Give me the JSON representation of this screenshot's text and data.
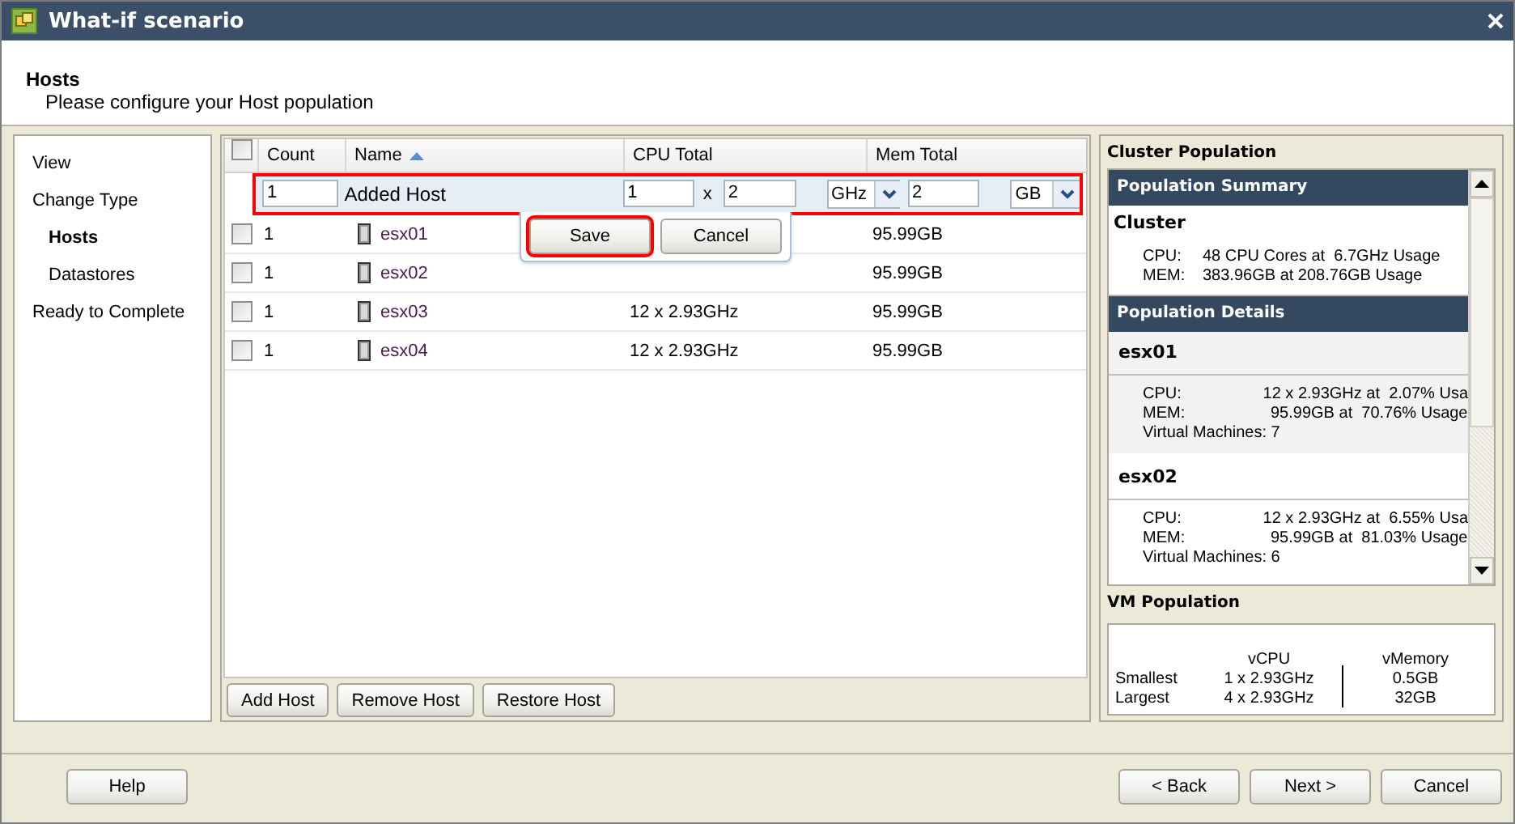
{
  "window": {
    "title": "What-if scenario"
  },
  "header": {
    "title": "Hosts",
    "subtitle": "Please configure your Host population"
  },
  "sidebar": {
    "items": [
      {
        "label": "View",
        "selected": false
      },
      {
        "label": "Change Type",
        "selected": false,
        "children": [
          {
            "label": "Hosts",
            "selected": true
          },
          {
            "label": "Datastores",
            "selected": false
          }
        ]
      },
      {
        "label": "Ready to Complete",
        "selected": false
      }
    ]
  },
  "table": {
    "all_checked": false,
    "columns": [
      {
        "label": "Count",
        "sorted": false
      },
      {
        "label": "Name",
        "sorted": true
      },
      {
        "label": "CPU Total",
        "sorted": false
      },
      {
        "label": "Mem Total",
        "sorted": false
      }
    ],
    "edit_row": {
      "highlighted": true,
      "count": "1",
      "name": "Added Host",
      "cpu_count": "1",
      "separator": "x",
      "cpu_speed": "2",
      "cpu_unit": "GHz",
      "mem": "2",
      "mem_unit": "GB"
    },
    "edit_actions": [
      {
        "label": "Save",
        "highlighted": true
      },
      {
        "label": "Cancel",
        "highlighted": false
      }
    ],
    "rows": [
      {
        "checked": false,
        "count": "1",
        "name": "esx01",
        "mem": "95.99GB"
      },
      {
        "checked": false,
        "count": "1",
        "name": "esx02",
        "mem": "95.99GB"
      },
      {
        "checked": false,
        "count": "1",
        "name": "esx03",
        "cpu": "12 x 2.93GHz",
        "mem": "95.99GB"
      },
      {
        "checked": false,
        "count": "1",
        "name": "esx04",
        "cpu": "12 x 2.93GHz",
        "mem": "95.99GB"
      }
    ]
  },
  "table_buttons": [
    "Add Host",
    "Remove Host",
    "Restore Host"
  ],
  "cluster_population": {
    "title": "Cluster Population",
    "summary": {
      "heading": "Population Summary",
      "name": "Cluster",
      "lines": [
        {
          "label": "CPU:",
          "value": "48 CPU Cores at  6.7GHz Usage"
        },
        {
          "label": "MEM:",
          "value": "383.96GB at 208.76GB Usage"
        }
      ]
    },
    "details": {
      "heading": "Population Details",
      "hosts": [
        {
          "name": "esx01",
          "lines": [
            {
              "label": "CPU:",
              "value": "12 x 2.93GHz at  2.07% Usa"
            },
            {
              "label": "MEM:",
              "value": "95.99GB at  70.76% Usage"
            }
          ],
          "vms": "Virtual Machines: 7"
        },
        {
          "name": "esx02",
          "lines": [
            {
              "label": "CPU:",
              "value": "12 x 2.93GHz at  6.55% Usa"
            },
            {
              "label": "MEM:",
              "value": "95.99GB at  81.03% Usage"
            }
          ],
          "vms": "Virtual Machines: 6"
        }
      ]
    }
  },
  "vm_population": {
    "title": "VM Population",
    "columns": [
      "vCPU",
      "vMemory"
    ],
    "rows": [
      {
        "label": "Smallest",
        "vcpu": "1 x 2.93GHz",
        "vmemory": "0.5GB"
      },
      {
        "label": "Largest",
        "vcpu": "4 x 2.93GHz",
        "vmemory": "32GB"
      }
    ]
  },
  "footer": {
    "help": "Help",
    "buttons": [
      "< Back",
      "Next >",
      "Cancel"
    ]
  }
}
